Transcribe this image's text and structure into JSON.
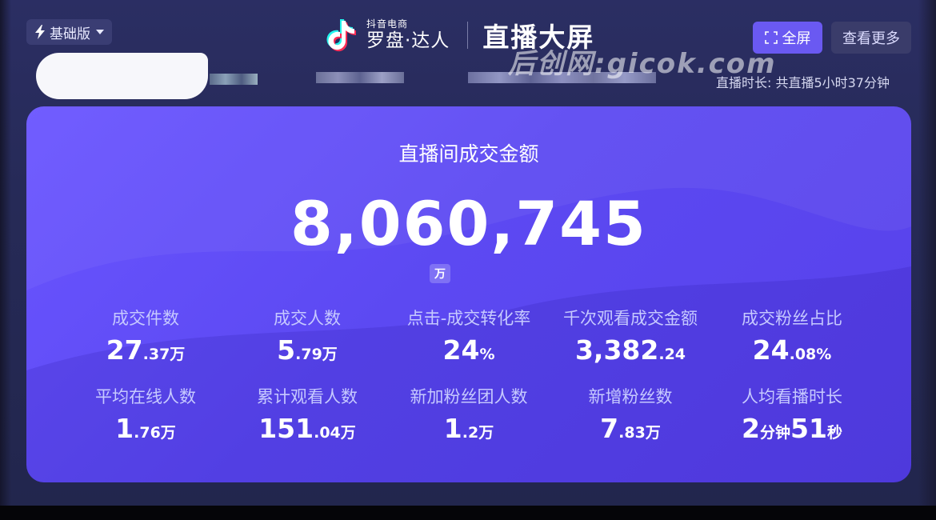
{
  "header": {
    "version_label": "基础版",
    "logo_sub": "抖音电商",
    "logo_main": "罗盘·达人",
    "title": "直播大屏",
    "fullscreen_label": "全屏",
    "more_label": "查看更多",
    "watermark": "后创网:gicok.com",
    "live_duration": "直播时长: 共直播5小时37分钟"
  },
  "panel": {
    "title": "直播间成交金额",
    "amount": "8,060,745",
    "unit": "万"
  },
  "metrics": [
    {
      "label": "成交件数",
      "main": "27",
      "small": ".37万",
      "main2": "",
      "small2": ""
    },
    {
      "label": "成交人数",
      "main": "5",
      "small": ".79万",
      "main2": "",
      "small2": ""
    },
    {
      "label": "点击-成交转化率",
      "main": "24",
      "small": "%",
      "main2": "",
      "small2": ""
    },
    {
      "label": "千次观看成交金额",
      "main": "3,382",
      "small": ".24",
      "main2": "",
      "small2": ""
    },
    {
      "label": "成交粉丝占比",
      "main": "24",
      "small": ".08%",
      "main2": "",
      "small2": ""
    },
    {
      "label": "平均在线人数",
      "main": "1",
      "small": ".76万",
      "main2": "",
      "small2": ""
    },
    {
      "label": "累计观看人数",
      "main": "151",
      "small": ".04万",
      "main2": "",
      "small2": ""
    },
    {
      "label": "新加粉丝团人数",
      "main": "1",
      "small": ".2万",
      "main2": "",
      "small2": ""
    },
    {
      "label": "新增粉丝数",
      "main": "7",
      "small": ".83万",
      "main2": "",
      "small2": ""
    },
    {
      "label": "人均看播时长",
      "main": "2",
      "small": "分钟",
      "main2": "51",
      "small2": "秒"
    }
  ],
  "colors": {
    "panel": "#5c49f2",
    "accent_button": "#6a59f2",
    "background": "#262a57"
  },
  "icons": [
    "lightning-icon",
    "chevron-down-icon",
    "tiktok-logo-icon",
    "fullscreen-icon"
  ]
}
